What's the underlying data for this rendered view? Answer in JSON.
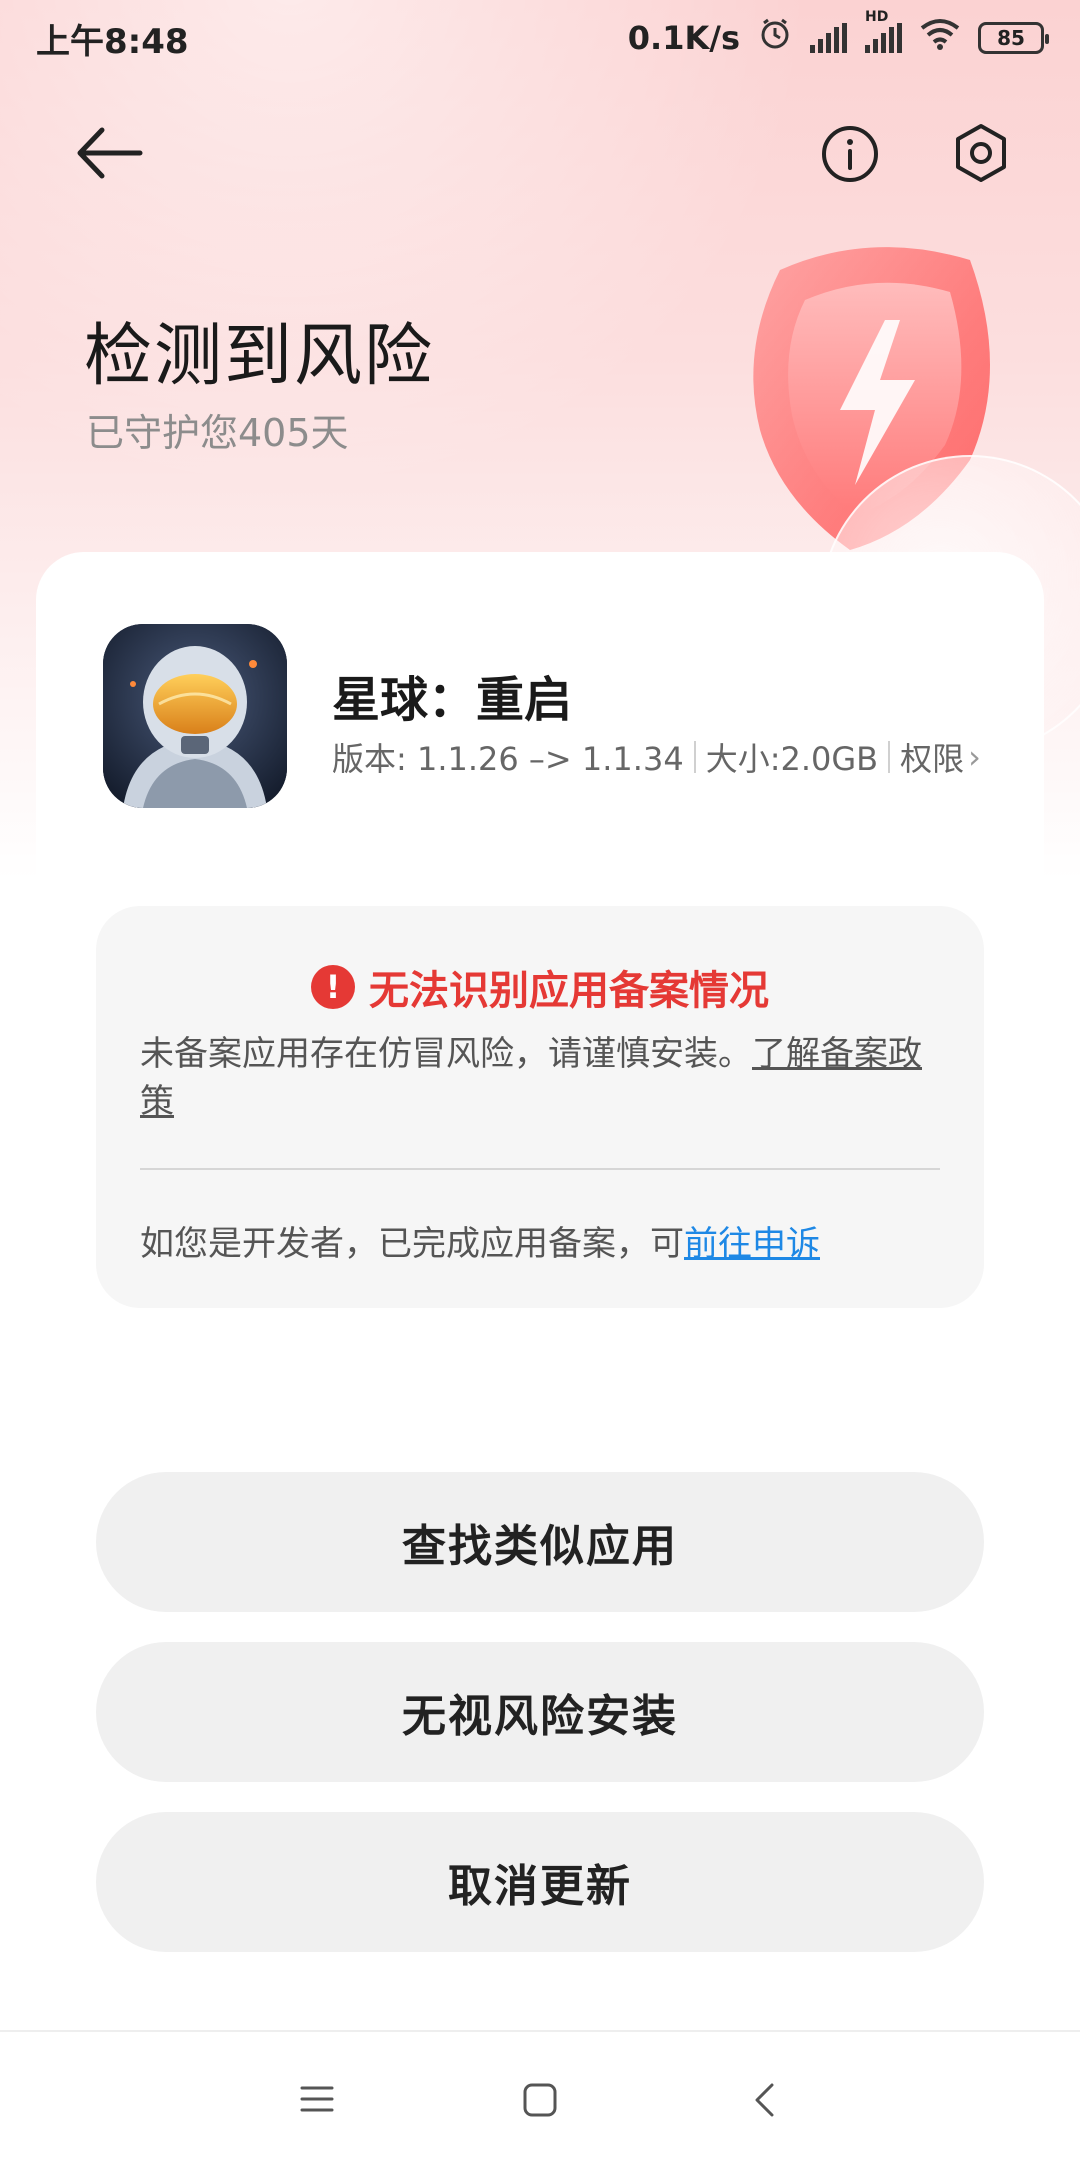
{
  "status_bar": {
    "time": "上午8:48",
    "network_speed": "0.1K/s",
    "hd_label": "HD",
    "battery": "85"
  },
  "header": {
    "title": "检测到风险",
    "subtitle": "已守护您405天"
  },
  "app": {
    "name": "星球：重启",
    "version": "版本: 1.1.26 –> 1.1.34",
    "size": "大小:2.0GB",
    "permissions": "权限"
  },
  "warning": {
    "title": "无法识别应用备案情况",
    "body": "未备案应用存在仿冒风险，请谨慎安装。",
    "policy_link": "了解备案政策",
    "footer": "如您是开发者，已完成应用备案，可",
    "appeal_link": "前往申诉"
  },
  "buttons": {
    "find_similar": "查找类似应用",
    "ignore_install": "无视风险安装",
    "cancel_update": "取消更新"
  },
  "colors": {
    "danger": "#e53935",
    "link": "#1e88e5",
    "accent_bg": "#fbd2d2"
  }
}
